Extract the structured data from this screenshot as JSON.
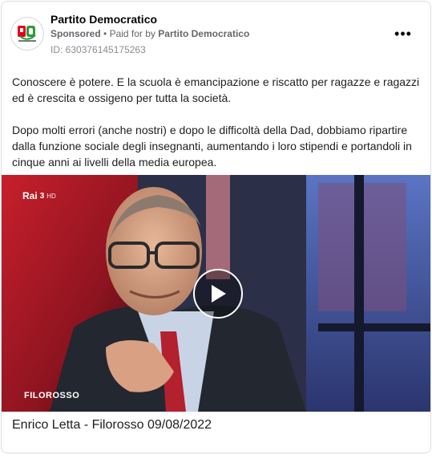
{
  "post": {
    "page_name": "Partito Democratico",
    "sponsored_label": "Sponsored",
    "separator": "•",
    "paid_for_prefix": "Paid for by",
    "paid_for_name": "Partito Democratico",
    "ad_id": "ID: 630376145175263",
    "more_icon": "more-horizontal-icon",
    "more_glyph": "•••",
    "logo_text": "PD",
    "body_paragraphs": [
      "Conoscere è potere. E la scuola è emancipazione e riscatto per ragazze e ragazzi ed è crescita e ossigeno per tutta la società.",
      "Dopo molti errori (anche nostri) e dopo le difficoltà della Dad, dobbiamo ripartire dalla funzione sociale degli insegnanti, aumentando i loro stipendi e portandoli in cinque anni ai livelli della media europea."
    ],
    "video": {
      "channel_name": "Rai",
      "channel_number": "3",
      "channel_badge": "HD",
      "show_logo": "FILOROSSO",
      "play_icon": "play-icon"
    },
    "caption": "Enrico Letta - Filorosso 09/08/2022"
  }
}
